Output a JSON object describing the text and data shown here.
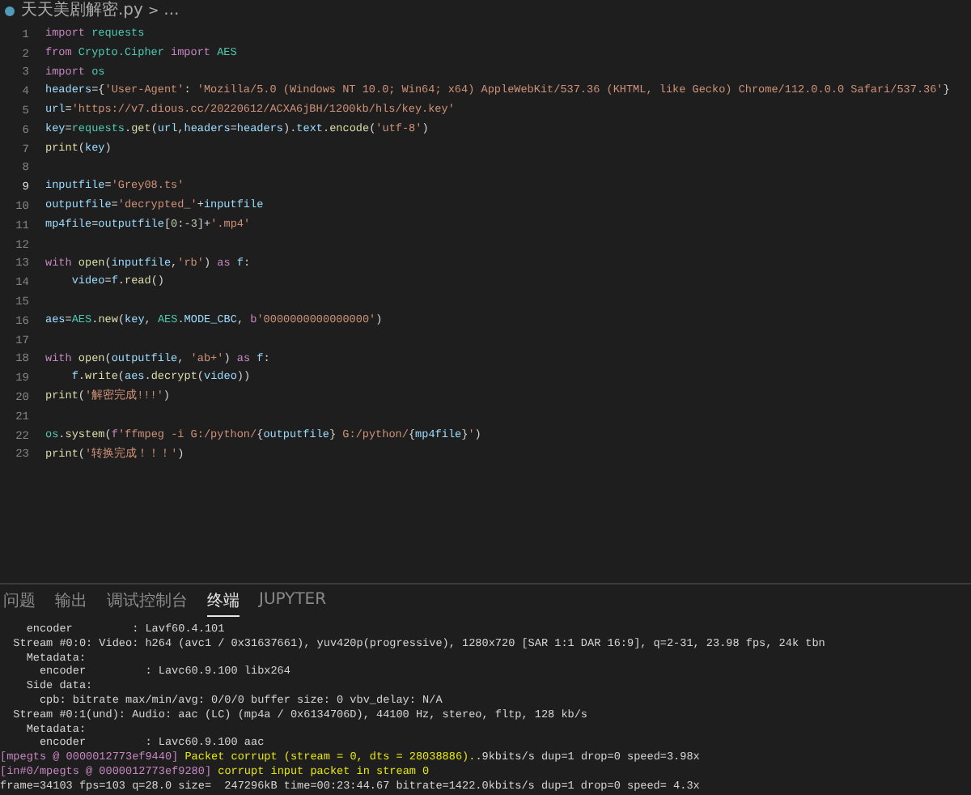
{
  "breadcrumb": {
    "file": "天天美剧解密.py",
    "separator": ">",
    "rest": "..."
  },
  "code": [
    {
      "number": "1",
      "current": false,
      "tokens": [
        {
          "kind": "kw",
          "text": "import "
        },
        {
          "kind": "mod",
          "text": "requests"
        }
      ]
    },
    {
      "number": "2",
      "current": false,
      "tokens": [
        {
          "kind": "kw",
          "text": "from "
        },
        {
          "kind": "mod",
          "text": "Crypto.Cipher "
        },
        {
          "kind": "kw",
          "text": "import "
        },
        {
          "kind": "mod",
          "text": "AES"
        }
      ]
    },
    {
      "number": "3",
      "current": false,
      "tokens": [
        {
          "kind": "kw",
          "text": "import "
        },
        {
          "kind": "mod",
          "text": "os"
        }
      ]
    },
    {
      "number": "4",
      "current": false,
      "tokens": [
        {
          "kind": "var",
          "text": "headers"
        },
        {
          "kind": "plain",
          "text": "={"
        },
        {
          "kind": "str",
          "text": "'User-Agent'"
        },
        {
          "kind": "plain",
          "text": ": "
        },
        {
          "kind": "str",
          "text": "'Mozilla/5.0 (Windows NT 10.0; Win64; x64) AppleWebKit/537.36 (KHTML, like Gecko) Chrome/112.0.0.0 Safari/537.36'"
        },
        {
          "kind": "plain",
          "text": "}"
        }
      ]
    },
    {
      "number": "5",
      "current": false,
      "tokens": [
        {
          "kind": "var",
          "text": "url"
        },
        {
          "kind": "plain",
          "text": "="
        },
        {
          "kind": "str",
          "text": "'https://v7.dious.cc/20220612/ACXA6jBH/1200kb/hls/key.key'"
        }
      ]
    },
    {
      "number": "6",
      "current": false,
      "tokens": [
        {
          "kind": "var",
          "text": "key"
        },
        {
          "kind": "plain",
          "text": "="
        },
        {
          "kind": "mod",
          "text": "requests"
        },
        {
          "kind": "plain",
          "text": "."
        },
        {
          "kind": "fn",
          "text": "get"
        },
        {
          "kind": "plain",
          "text": "("
        },
        {
          "kind": "var",
          "text": "url"
        },
        {
          "kind": "plain",
          "text": ","
        },
        {
          "kind": "var",
          "text": "headers"
        },
        {
          "kind": "plain",
          "text": "="
        },
        {
          "kind": "var",
          "text": "headers"
        },
        {
          "kind": "plain",
          "text": ")."
        },
        {
          "kind": "var",
          "text": "text"
        },
        {
          "kind": "plain",
          "text": "."
        },
        {
          "kind": "fn",
          "text": "encode"
        },
        {
          "kind": "plain",
          "text": "("
        },
        {
          "kind": "str",
          "text": "'utf-8'"
        },
        {
          "kind": "plain",
          "text": ")"
        }
      ]
    },
    {
      "number": "7",
      "current": false,
      "tokens": [
        {
          "kind": "fn",
          "text": "print"
        },
        {
          "kind": "plain",
          "text": "("
        },
        {
          "kind": "var",
          "text": "key"
        },
        {
          "kind": "plain",
          "text": ")"
        }
      ]
    },
    {
      "number": "8",
      "current": false
    },
    {
      "number": "9",
      "current": true,
      "tokens": [
        {
          "kind": "var",
          "text": "inputfile"
        },
        {
          "kind": "plain",
          "text": "="
        },
        {
          "kind": "str",
          "text": "'Grey08.ts'"
        }
      ]
    },
    {
      "number": "10",
      "current": false,
      "tokens": [
        {
          "kind": "var",
          "text": "outputfile"
        },
        {
          "kind": "plain",
          "text": "="
        },
        {
          "kind": "str",
          "text": "'decrypted_'"
        },
        {
          "kind": "plain",
          "text": "+"
        },
        {
          "kind": "var",
          "text": "inputfile"
        }
      ]
    },
    {
      "number": "11",
      "current": false,
      "tokens": [
        {
          "kind": "var",
          "text": "mp4file"
        },
        {
          "kind": "plain",
          "text": "="
        },
        {
          "kind": "var",
          "text": "outputfile"
        },
        {
          "kind": "plain",
          "text": "["
        },
        {
          "kind": "num",
          "text": "0"
        },
        {
          "kind": "plain",
          "text": ":-"
        },
        {
          "kind": "num",
          "text": "3"
        },
        {
          "kind": "plain",
          "text": "]+"
        },
        {
          "kind": "str",
          "text": "'.mp4'"
        }
      ]
    },
    {
      "number": "12",
      "current": false
    },
    {
      "number": "13",
      "current": false,
      "tokens": [
        {
          "kind": "kw",
          "text": "with "
        },
        {
          "kind": "fn",
          "text": "open"
        },
        {
          "kind": "plain",
          "text": "("
        },
        {
          "kind": "var",
          "text": "inputfile"
        },
        {
          "kind": "plain",
          "text": ","
        },
        {
          "kind": "str",
          "text": "'rb'"
        },
        {
          "kind": "plain",
          "text": ") "
        },
        {
          "kind": "kw",
          "text": "as "
        },
        {
          "kind": "var",
          "text": "f"
        },
        {
          "kind": "plain",
          "text": ":"
        }
      ]
    },
    {
      "number": "14",
      "current": false,
      "tokens": [
        {
          "kind": "var",
          "text": "    video"
        },
        {
          "kind": "plain",
          "text": "="
        },
        {
          "kind": "var",
          "text": "f"
        },
        {
          "kind": "plain",
          "text": "."
        },
        {
          "kind": "fn",
          "text": "read"
        },
        {
          "kind": "plain",
          "text": "()"
        }
      ]
    },
    {
      "number": "15",
      "current": false
    },
    {
      "number": "16",
      "current": false,
      "tokens": [
        {
          "kind": "var",
          "text": "aes"
        },
        {
          "kind": "plain",
          "text": "="
        },
        {
          "kind": "mod",
          "text": "AES"
        },
        {
          "kind": "plain",
          "text": "."
        },
        {
          "kind": "fn",
          "text": "new"
        },
        {
          "kind": "plain",
          "text": "("
        },
        {
          "kind": "var",
          "text": "key"
        },
        {
          "kind": "plain",
          "text": ", "
        },
        {
          "kind": "mod",
          "text": "AES"
        },
        {
          "kind": "plain",
          "text": "."
        },
        {
          "kind": "var",
          "text": "MODE_CBC"
        },
        {
          "kind": "plain",
          "text": ", "
        },
        {
          "kind": "kw",
          "text": "b"
        },
        {
          "kind": "str",
          "text": "'0000000000000000'"
        },
        {
          "kind": "plain",
          "text": ")"
        }
      ]
    },
    {
      "number": "17",
      "current": false
    },
    {
      "number": "18",
      "current": false,
      "tokens": [
        {
          "kind": "kw",
          "text": "with "
        },
        {
          "kind": "fn",
          "text": "open"
        },
        {
          "kind": "plain",
          "text": "("
        },
        {
          "kind": "var",
          "text": "outputfile"
        },
        {
          "kind": "plain",
          "text": ", "
        },
        {
          "kind": "str",
          "text": "'ab+'"
        },
        {
          "kind": "plain",
          "text": ") "
        },
        {
          "kind": "kw",
          "text": "as "
        },
        {
          "kind": "var",
          "text": "f"
        },
        {
          "kind": "plain",
          "text": ":"
        }
      ]
    },
    {
      "number": "19",
      "current": false,
      "tokens": [
        {
          "kind": "var",
          "text": "    f"
        },
        {
          "kind": "plain",
          "text": "."
        },
        {
          "kind": "fn",
          "text": "write"
        },
        {
          "kind": "plain",
          "text": "("
        },
        {
          "kind": "var",
          "text": "aes"
        },
        {
          "kind": "plain",
          "text": "."
        },
        {
          "kind": "fn",
          "text": "decrypt"
        },
        {
          "kind": "plain",
          "text": "("
        },
        {
          "kind": "var",
          "text": "video"
        },
        {
          "kind": "plain",
          "text": "))"
        }
      ]
    },
    {
      "number": "20",
      "current": false,
      "tokens": [
        {
          "kind": "fn",
          "text": "print"
        },
        {
          "kind": "plain",
          "text": "("
        },
        {
          "kind": "str",
          "text": "'解密完成!!!'"
        },
        {
          "kind": "plain",
          "text": ")"
        }
      ]
    },
    {
      "number": "21",
      "current": false
    },
    {
      "number": "22",
      "current": false,
      "tokens": [
        {
          "kind": "mod",
          "text": "os"
        },
        {
          "kind": "plain",
          "text": "."
        },
        {
          "kind": "fn",
          "text": "system"
        },
        {
          "kind": "plain",
          "text": "("
        },
        {
          "kind": "kw",
          "text": "f"
        },
        {
          "kind": "str",
          "text": "'ffmpeg -i G:/python/"
        },
        {
          "kind": "plain",
          "text": "{"
        },
        {
          "kind": "var",
          "text": "outputfile"
        },
        {
          "kind": "plain",
          "text": "}"
        },
        {
          "kind": "str",
          "text": " G:/python/"
        },
        {
          "kind": "plain",
          "text": "{"
        },
        {
          "kind": "var",
          "text": "mp4file"
        },
        {
          "kind": "plain",
          "text": "}"
        },
        {
          "kind": "str",
          "text": "'"
        },
        {
          "kind": "plain",
          "text": ")"
        }
      ]
    },
    {
      "number": "23",
      "current": false,
      "tokens": [
        {
          "kind": "fn",
          "text": "print"
        },
        {
          "kind": "plain",
          "text": "("
        },
        {
          "kind": "str",
          "text": "'转换完成！！！'"
        },
        {
          "kind": "plain",
          "text": ")"
        }
      ]
    }
  ],
  "panel_tabs": [
    {
      "label": "问题",
      "selected": false
    },
    {
      "label": "输出",
      "selected": false
    },
    {
      "label": "调试控制台",
      "selected": false
    },
    {
      "label": "终端",
      "selected": true
    },
    {
      "label": "JUPYTER",
      "selected": false
    }
  ],
  "terminal": [
    {
      "tokens": [
        {
          "kind": "plain",
          "text": "    encoder         : Lavf60.4.101"
        }
      ]
    },
    {
      "tokens": [
        {
          "kind": "plain",
          "text": "  Stream #0:0: Video: h264 (avc1 / 0x31637661), yuv420p(progressive), 1280x720 [SAR 1:1 DAR 16:9], q=2-31, 23.98 fps, 24k tbn"
        }
      ]
    },
    {
      "tokens": [
        {
          "kind": "plain",
          "text": "    Metadata:"
        }
      ]
    },
    {
      "tokens": [
        {
          "kind": "plain",
          "text": "      encoder         : Lavc60.9.100 libx264"
        }
      ]
    },
    {
      "tokens": [
        {
          "kind": "plain",
          "text": "    Side data:"
        }
      ]
    },
    {
      "tokens": [
        {
          "kind": "plain",
          "text": "      cpb: bitrate max/min/avg: 0/0/0 buffer size: 0 vbv_delay: N/A"
        }
      ]
    },
    {
      "tokens": [
        {
          "kind": "plain",
          "text": "  Stream #0:1(und): Audio: aac (LC) (mp4a / 0x6134706D), 44100 Hz, stereo, fltp, 128 kb/s"
        }
      ]
    },
    {
      "tokens": [
        {
          "kind": "plain",
          "text": "    Metadata:"
        }
      ]
    },
    {
      "tokens": [
        {
          "kind": "plain",
          "text": "      encoder         : Lavc60.9.100 aac"
        }
      ]
    },
    {
      "tokens": [
        {
          "kind": "tag",
          "text": "[mpegts @ 0000012773ef9440]"
        },
        {
          "kind": "warn",
          "text": " Packet corrupt (stream = 0, dts = 28038886)."
        },
        {
          "kind": "plain",
          "text": ".9kbits/s dup=1 drop=0 speed=3.98x"
        }
      ]
    },
    {
      "tokens": [
        {
          "kind": "tag",
          "text": "[in#0/mpegts @ 0000012773ef9280]"
        },
        {
          "kind": "warn",
          "text": " corrupt input packet in stream 0"
        }
      ]
    },
    {
      "tokens": [
        {
          "kind": "plain",
          "text": "frame=34103 fps=103 q=28.0 size=  247296kB time=00:23:44.67 bitrate=1422.0kbits/s dup=1 drop=0 speed= 4.3x"
        }
      ]
    }
  ]
}
